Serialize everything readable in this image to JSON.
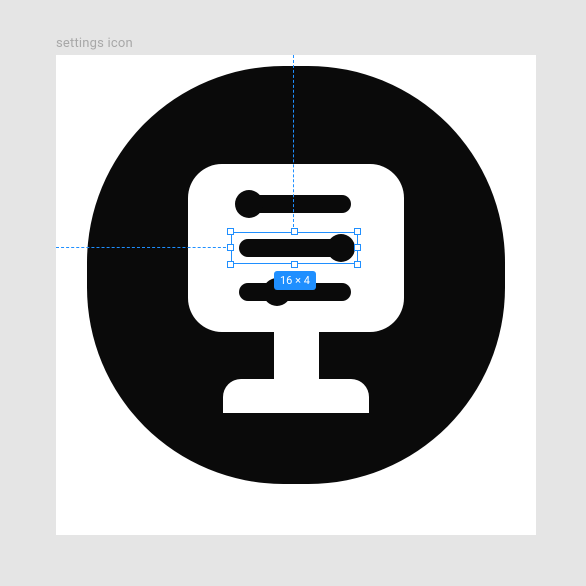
{
  "layer": {
    "name": "settings icon"
  },
  "selection": {
    "size_label": "16 × 4"
  },
  "colors": {
    "accent": "#1f8fff",
    "bg": "#e5e5e5",
    "canvas": "#ffffff",
    "icon_fg": "#0a0a0a"
  }
}
